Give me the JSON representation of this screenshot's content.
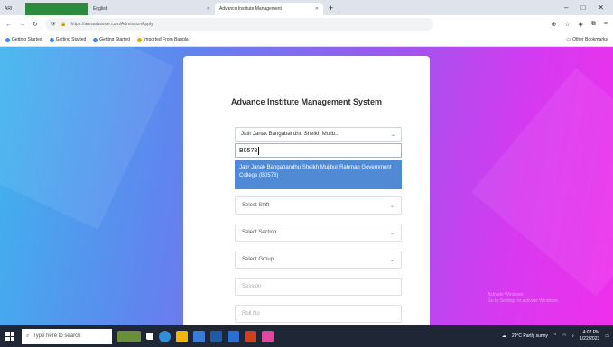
{
  "browser": {
    "tabs": [
      {
        "label": "ARI",
        "kind": "small"
      },
      {
        "label": "",
        "kind": "task"
      },
      {
        "label": "English",
        "kind": "mid"
      },
      {
        "label": "Advance Institute Management",
        "kind": "active"
      }
    ],
    "new_tab": "+",
    "address": "https://amsadvance.com/AdmissionApply",
    "bookmarks": [
      {
        "label": "Getting Started"
      },
      {
        "label": "Getting Started"
      },
      {
        "label": "Getting Started"
      },
      {
        "label": "Imported From Bangla"
      }
    ],
    "other_bookmarks": "Other Bookmarks"
  },
  "form": {
    "title": "Advance Institute Management System",
    "institution_selected": "Jatir Janak Bangabandhu Sheikh Mujib...",
    "search_value": "B0578",
    "dropdown_option": "Jatir Janak Bangabandhu Sheikh Mujibur Rahman Government College (B0578)",
    "shift_placeholder": "Select Shift",
    "section_placeholder": "Select Section",
    "group_placeholder": "Select Group",
    "session_placeholder": "Session",
    "roll_placeholder": "Roll No"
  },
  "watermark": {
    "line1": "Activate Windows",
    "line2": "Go to Settings to activate Windows."
  },
  "taskbar": {
    "search_placeholder": "Type here to search",
    "weather": "29°C Partly sunny",
    "time": "4:07 PM",
    "date": "1/22/2023"
  },
  "colors": {
    "gradient_start": "#3fb4ee",
    "gradient_end": "#ef2fec",
    "option_highlight": "#5089d4",
    "taskbar": "#1f2736"
  }
}
